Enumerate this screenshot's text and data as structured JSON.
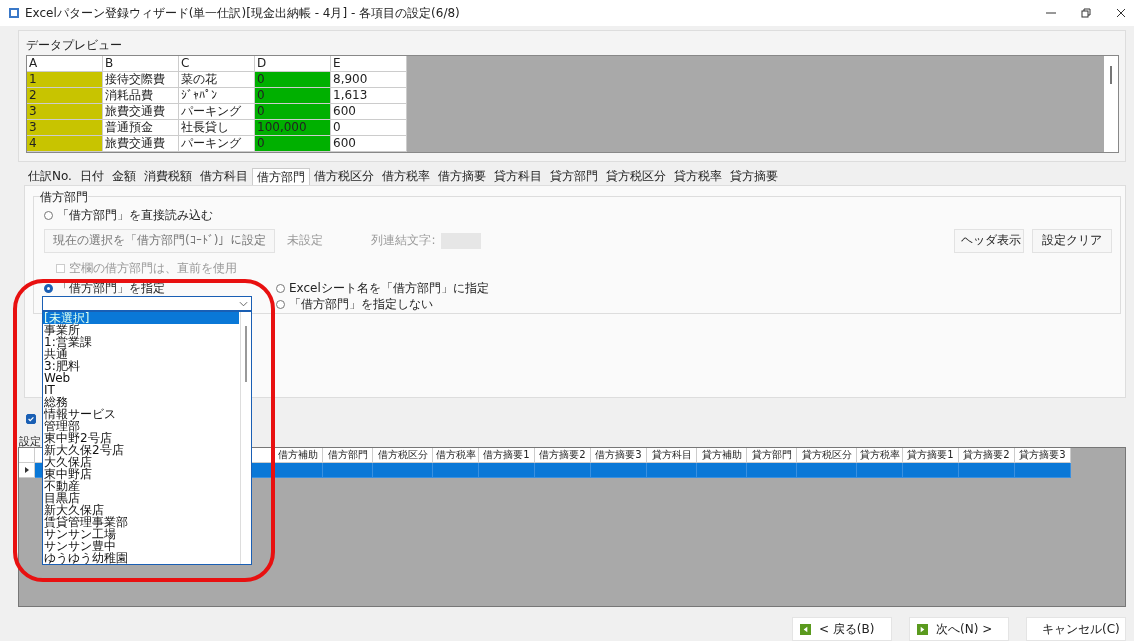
{
  "window": {
    "title": "Excelパターン登録ウィザード(単一仕訳)[現金出納帳 - 4月] - 各項目の設定(6/8)"
  },
  "preview": {
    "label": "データプレビュー",
    "columns": [
      {
        "name": "A",
        "color": "#c8c400"
      },
      {
        "name": "B"
      },
      {
        "name": "C"
      },
      {
        "name": "D",
        "color": "#00b000"
      },
      {
        "name": "E"
      }
    ],
    "rows": [
      [
        "1",
        "接待交際費",
        "菜の花",
        "0",
        "8,900"
      ],
      [
        "2",
        "消耗品費",
        "ｼﾞｬﾊﾟﾝ",
        "0",
        "1,613"
      ],
      [
        "3",
        "旅費交通費",
        "パーキング",
        "0",
        "600"
      ],
      [
        "3",
        "普通預金",
        "社長貸し",
        "100,000",
        "0"
      ],
      [
        "4",
        "旅費交通費",
        "パーキング",
        "0",
        "600"
      ]
    ]
  },
  "tabs": [
    {
      "label": "仕訳No.",
      "selected": false
    },
    {
      "label": "日付",
      "selected": false
    },
    {
      "label": "金額",
      "selected": false
    },
    {
      "label": "消費税額",
      "selected": false
    },
    {
      "label": "借方科目",
      "selected": false
    },
    {
      "label": "借方部門",
      "selected": true
    },
    {
      "label": "借方税区分",
      "selected": false
    },
    {
      "label": "借方税率",
      "selected": false
    },
    {
      "label": "借方摘要",
      "selected": false
    },
    {
      "label": "貸方科目",
      "selected": false
    },
    {
      "label": "貸方部門",
      "selected": false
    },
    {
      "label": "貸方税区分",
      "selected": false
    },
    {
      "label": "貸方税率",
      "selected": false
    },
    {
      "label": "貸方摘要",
      "selected": false
    }
  ],
  "panel": {
    "legend": "借方部門",
    "direct_radio": {
      "label": "「借方部門」を直接読み込む",
      "selected": false
    },
    "set_button": {
      "label": "現在の選択を「借方部門(ｺｰﾄﾞ)」に設定",
      "disabled": true
    },
    "status": "未設定",
    "joiner_label": "列連結文字:",
    "header_button": "ヘッダ表示",
    "clear_button": "設定クリア",
    "blank_checkbox": {
      "label": "空欄の借方部門は、直前を使用",
      "checked": false,
      "disabled": true
    },
    "specify_radio": {
      "label": "「借方部門」を指定",
      "selected": true
    },
    "sheet_radio": {
      "label": "Excelシート名を「借方部門」に指定",
      "selected": false
    },
    "none_radio": {
      "label": "「借方部門」を指定しない",
      "selected": false
    },
    "combo": {
      "expanded": true,
      "items": [
        {
          "label": "[未選択]",
          "selected": true
        },
        {
          "label": "事業所",
          "selected": false
        },
        {
          "label": "1:営業課",
          "selected": false
        },
        {
          "label": "共通",
          "selected": false
        },
        {
          "label": "3:肥料",
          "selected": false
        },
        {
          "label": "Web",
          "selected": false
        },
        {
          "label": "IT",
          "selected": false
        },
        {
          "label": "総務",
          "selected": false
        },
        {
          "label": "情報サービス",
          "selected": false
        },
        {
          "label": "管理部",
          "selected": false
        },
        {
          "label": "東中野2号店",
          "selected": false
        },
        {
          "label": "新大久保2号店",
          "selected": false
        },
        {
          "label": "大久保店",
          "selected": false
        },
        {
          "label": "東中野店",
          "selected": false
        },
        {
          "label": "不動産",
          "selected": false
        },
        {
          "label": "目黒店",
          "selected": false
        },
        {
          "label": "新大久保店",
          "selected": false
        },
        {
          "label": "賃貸管理事業部",
          "selected": false
        },
        {
          "label": "サンサン工場",
          "selected": false
        },
        {
          "label": "サンサン豊中",
          "selected": false
        },
        {
          "label": "ゆうゆう幼稚園",
          "selected": false
        }
      ]
    }
  },
  "use_checkbox": {
    "checked": true
  },
  "settings_label": "設定",
  "grid": {
    "columns": [
      "借方補助",
      "借方部門",
      "借方税区分",
      "借方税率",
      "借方摘要1",
      "借方摘要2",
      "借方摘要3",
      "貸方科目",
      "貸方補助",
      "貸方部門",
      "貸方税区分",
      "貸方税率",
      "貸方摘要1",
      "貸方摘要2",
      "貸方摘要3"
    ],
    "rows": [
      {
        "selected": true
      }
    ]
  },
  "buttons": [
    {
      "label": "< 戻る(B)",
      "kind": "back"
    },
    {
      "label": "次へ(N) >",
      "kind": "next"
    },
    {
      "label": "キャンセル(C)",
      "kind": "cancel"
    }
  ]
}
